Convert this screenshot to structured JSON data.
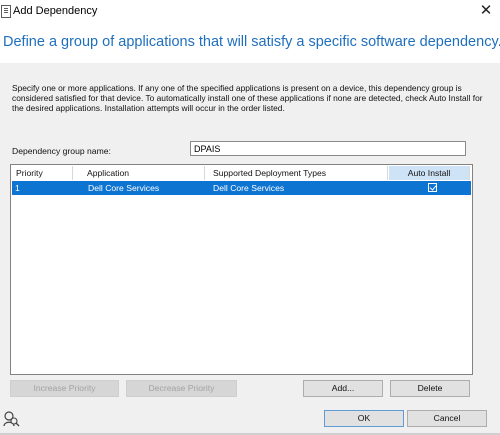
{
  "window": {
    "title": "Add Dependency",
    "close_glyph": "✕"
  },
  "heading": "Define a group of applications that will satisfy a specific software dependency.",
  "description": "Specify one or more applications. If any one of the specified applications is present on a device, this dependency group is considered satisfied for that device. To automatically install one of these applications if none are detected, check Auto Install for the desired applications. Installation attempts will occur in the order listed.",
  "form": {
    "group_name_label": "Dependency group name:",
    "group_name_value": "DPAIS"
  },
  "grid": {
    "columns": [
      "Priority",
      "Application",
      "Supported Deployment Types",
      "Auto Install"
    ],
    "rows": [
      {
        "priority": "1",
        "application": "Dell Core Services",
        "deployment_types": "Dell Core Services",
        "auto_install": true
      }
    ]
  },
  "buttons": {
    "increase_priority": "Increase Priority",
    "decrease_priority": "Decrease Priority",
    "add": "Add...",
    "delete": "Delete",
    "ok": "OK",
    "cancel": "Cancel"
  },
  "icons": {
    "window": "document-icon",
    "help": "person-search-icon"
  },
  "colors": {
    "heading": "#1f6fbf",
    "selection": "#0d74d1",
    "sorted_header": "#cfe3f7"
  }
}
